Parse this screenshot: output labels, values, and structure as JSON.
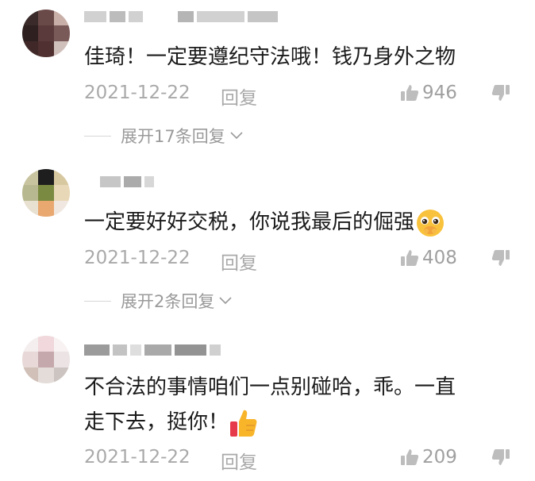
{
  "comments": [
    {
      "text": "佳琦！一定要遵纪守法哦！钱乃身外之物",
      "date": "2021-12-22",
      "reply_label": "回复",
      "likes": "946",
      "expand_label": "展开17条回复"
    },
    {
      "text": "一定要好好交税，你说我最后的倔强",
      "date": "2021-12-22",
      "reply_label": "回复",
      "likes": "408",
      "expand_label": "展开2条回复"
    },
    {
      "text_line1": "不合法的事情咱们一点别碰哈，乖。一直",
      "text_line2": "走下去，挺你！",
      "date": "2021-12-22",
      "reply_label": "回复",
      "likes": "209"
    }
  ],
  "icons": {
    "like": "thumbs-up-icon",
    "dislike": "thumbs-down-icon",
    "expand": "chevron-down-icon",
    "emoji_pleading": "pleading-face-emoji",
    "emoji_thumbs": "thumbs-up-emoji"
  },
  "colors": {
    "text": "#1b1b1b",
    "meta": "#a9a9a9"
  }
}
